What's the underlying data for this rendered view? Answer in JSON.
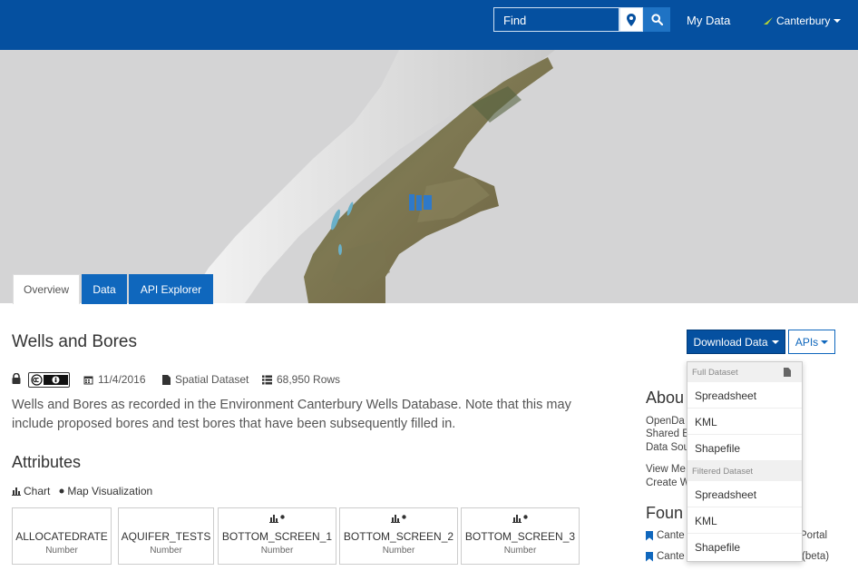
{
  "header": {
    "find_placeholder": "Find",
    "my_data_label": "My Data",
    "region_label": "Canterbury"
  },
  "tabs": [
    {
      "label": "Overview",
      "active": true
    },
    {
      "label": "Data",
      "active": false
    },
    {
      "label": "API Explorer",
      "active": false
    }
  ],
  "dataset": {
    "title": "Wells and Bores",
    "date": "11/4/2016",
    "type": "Spatial Dataset",
    "rows": "68,950 Rows",
    "description": "Wells and Bores as recorded in the Environment Canterbury Wells Database. Note that this may include proposed bores and test bores that have been subsequently filled in."
  },
  "actions": {
    "download_label": "Download Data",
    "apis_label": "APIs"
  },
  "download_menu": {
    "full_header": "Full Dataset",
    "full_items": [
      "Spreadsheet",
      "KML",
      "Shapefile"
    ],
    "filtered_header": "Filtered Dataset",
    "filtered_items": [
      "Spreadsheet",
      "KML",
      "Shapefile"
    ]
  },
  "attributes": {
    "title": "Attributes",
    "chart_label": "Chart",
    "map_label": "Map Visualization",
    "cards": [
      {
        "name": "ALLOCATEDRATE",
        "type": "Number"
      },
      {
        "name": "AQUIFER_TESTS",
        "type": "Number"
      },
      {
        "name": "BOTTOM_SCREEN_1",
        "type": "Number"
      },
      {
        "name": "BOTTOM_SCREEN_2",
        "type": "Number"
      },
      {
        "name": "BOTTOM_SCREEN_3",
        "type": "Number"
      }
    ]
  },
  "sidebar": {
    "about_title": "Abou",
    "about_lines": [
      "OpenDa",
      "Shared E",
      "Data Sou",
      "View Me",
      "Create W"
    ],
    "found_title": "Foun",
    "found_items": [
      {
        "left": "Cante",
        "right": "Portal"
      },
      {
        "left": "Cante",
        "right": "(beta)"
      }
    ]
  },
  "colors": {
    "header_blue": "#0550a0",
    "tab_blue": "#0f67bd",
    "accent_green": "#b5d334"
  }
}
